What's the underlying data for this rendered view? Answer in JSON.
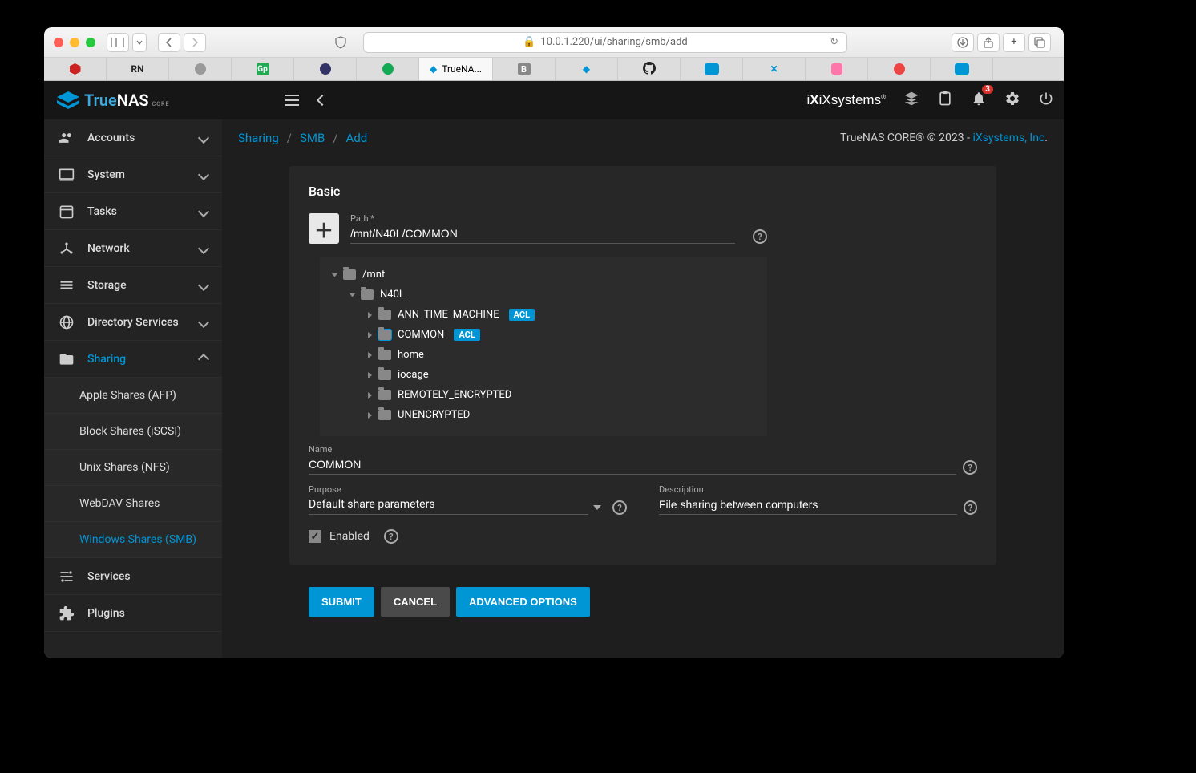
{
  "browser": {
    "url": "10.0.1.220/ui/sharing/smb/add",
    "active_tab": "TrueNA..."
  },
  "brand": {
    "p1": "True",
    "p2": "NAS",
    "sub": "CORE"
  },
  "topbar": {
    "ix": "iXsystems",
    "notif_count": "3"
  },
  "sidebar": {
    "items": [
      {
        "label": "Accounts",
        "icon": "people"
      },
      {
        "label": "System",
        "icon": "laptop"
      },
      {
        "label": "Tasks",
        "icon": "calendar"
      },
      {
        "label": "Network",
        "icon": "hub"
      },
      {
        "label": "Storage",
        "icon": "storage"
      },
      {
        "label": "Directory Services",
        "icon": "globe"
      },
      {
        "label": "Sharing",
        "icon": "folder-shared",
        "expanded": true,
        "active": true
      },
      {
        "label": "Services",
        "icon": "tune"
      },
      {
        "label": "Plugins",
        "icon": "extension"
      }
    ],
    "sharing_sub": [
      {
        "label": "Apple Shares (AFP)"
      },
      {
        "label": "Block Shares (iSCSI)"
      },
      {
        "label": "Unix Shares (NFS)"
      },
      {
        "label": "WebDAV Shares"
      },
      {
        "label": "Windows Shares (SMB)",
        "active": true
      }
    ]
  },
  "breadcrumb": {
    "a": "Sharing",
    "b": "SMB",
    "c": "Add"
  },
  "footer": {
    "left": "TrueNAS CORE® © 2023 - ",
    "link": "iXsystems, Inc"
  },
  "form": {
    "section": "Basic",
    "path_label": "Path *",
    "path_value": "/mnt/N40L/COMMON",
    "tree": {
      "root": "/mnt",
      "l1": "N40L",
      "children": [
        {
          "name": "ANN_TIME_MACHINE",
          "acl": true
        },
        {
          "name": "COMMON",
          "acl": true,
          "selected": true
        },
        {
          "name": "home"
        },
        {
          "name": "iocage"
        },
        {
          "name": "REMOTELY_ENCRYPTED"
        },
        {
          "name": "UNENCRYPTED"
        }
      ]
    },
    "name_label": "Name",
    "name_value": "COMMON",
    "purpose_label": "Purpose",
    "purpose_value": "Default share parameters",
    "desc_label": "Description",
    "desc_value": "File sharing between computers",
    "enabled_label": "Enabled",
    "btn_submit": "SUBMIT",
    "btn_cancel": "CANCEL",
    "btn_adv": "ADVANCED OPTIONS",
    "acl_tag": "ACL"
  }
}
